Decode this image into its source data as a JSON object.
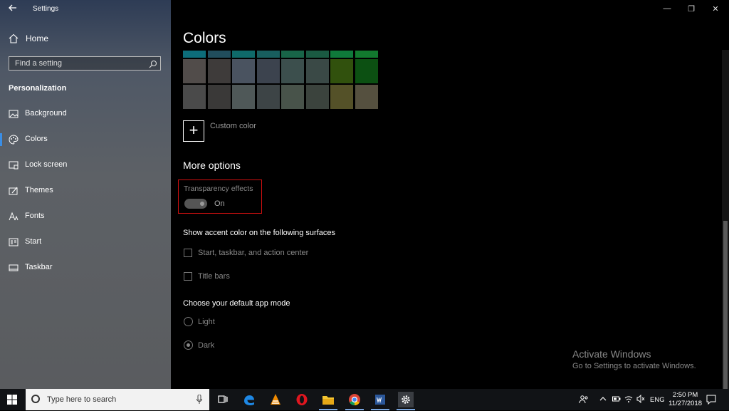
{
  "window": {
    "title": "Settings",
    "min": "—",
    "max": "❐",
    "close": "✕"
  },
  "sidebar": {
    "home": "Home",
    "search_placeholder": "Find a setting",
    "section": "Personalization",
    "items": [
      {
        "label": "Background",
        "icon": "picture-icon"
      },
      {
        "label": "Colors",
        "icon": "palette-icon"
      },
      {
        "label": "Lock screen",
        "icon": "lock-screen-icon"
      },
      {
        "label": "Themes",
        "icon": "brush-icon"
      },
      {
        "label": "Fonts",
        "icon": "font-icon"
      },
      {
        "label": "Start",
        "icon": "start-menu-icon"
      },
      {
        "label": "Taskbar",
        "icon": "taskbar-icon"
      }
    ],
    "active_index": 1
  },
  "main": {
    "title": "Colors",
    "swatch_rows": [
      [
        "#0d6d7a",
        "#214d5c",
        "#0f6a6a",
        "#185e5e",
        "#186548",
        "#1a5a42",
        "#0f7a3a",
        "#127a2e"
      ],
      [
        "#514c4a",
        "#3e3b3a",
        "#4a5360",
        "#3c434e",
        "#3c4f4d",
        "#3a4946",
        "#31510d",
        "#0c5012"
      ],
      [
        "#4a4a4a",
        "#3a3938",
        "#4f5858",
        "#3d4446",
        "#48534a",
        "#3b433d",
        "#545128",
        "#55503f"
      ]
    ],
    "custom_color": "Custom color",
    "more_options": "More options",
    "transparency": {
      "label": "Transparency effects",
      "state": "On"
    },
    "accent_heading": "Show accent color on the following surfaces",
    "checkboxes": [
      "Start, taskbar, and action center",
      "Title bars"
    ],
    "app_mode_heading": "Choose your default app mode",
    "radios": [
      {
        "label": "Light",
        "selected": false
      },
      {
        "label": "Dark",
        "selected": true
      }
    ]
  },
  "watermark": {
    "line1": "Activate Windows",
    "line2": "Go to Settings to activate Windows."
  },
  "taskbar": {
    "search_placeholder": "Type here to search",
    "apps": [
      "task-view-icon",
      "edge-icon",
      "vlc-icon",
      "opera-icon",
      "file-explorer-icon",
      "chrome-icon",
      "word-icon",
      "settings-icon"
    ],
    "lang": "ENG",
    "time": "2:50 PM",
    "date": "11/27/2018"
  }
}
